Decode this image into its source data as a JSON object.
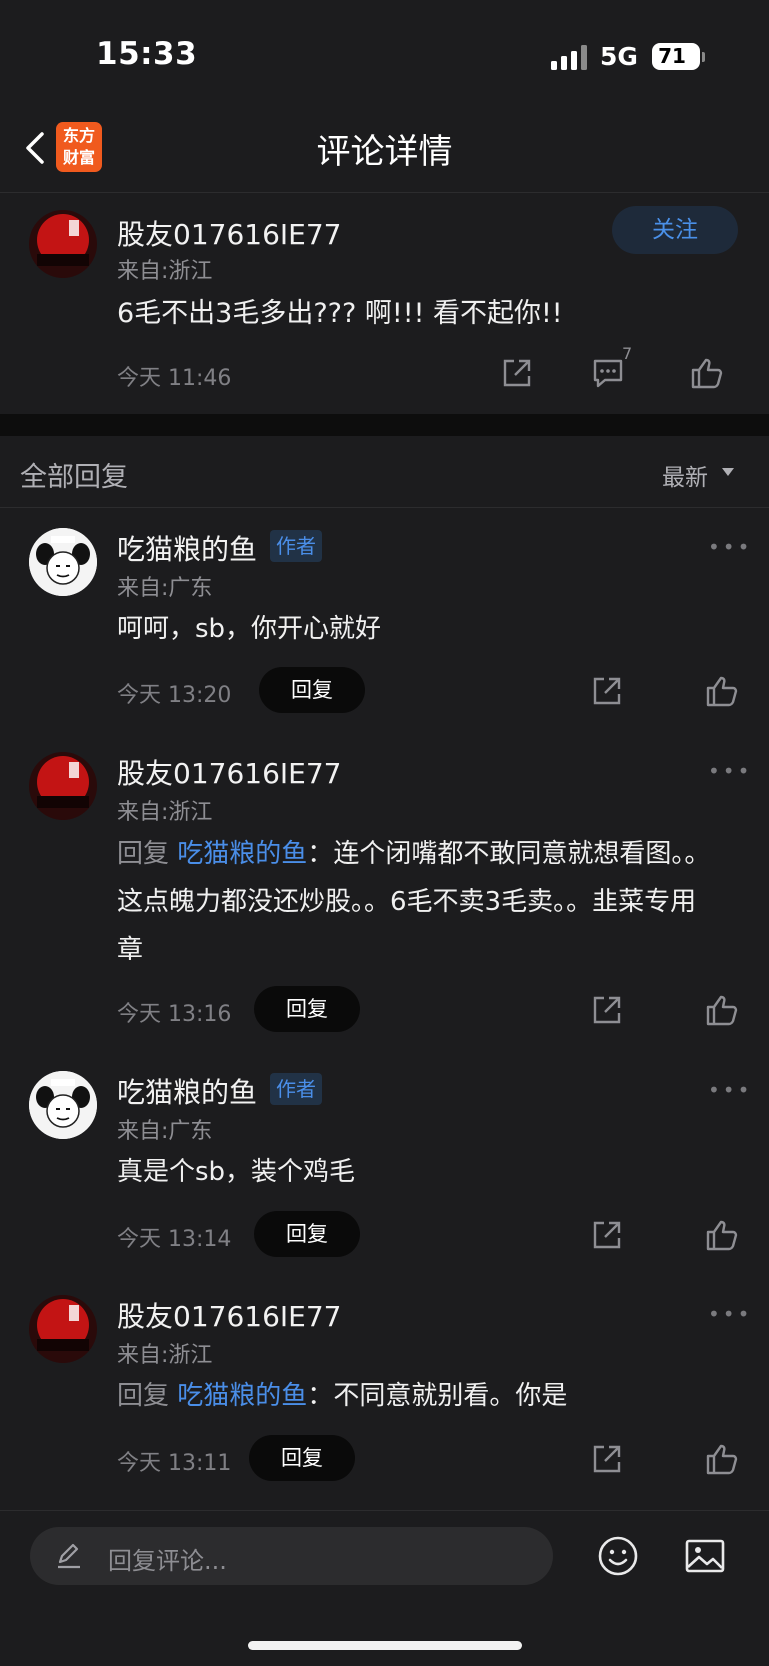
{
  "status_bar": {
    "time": "15:33",
    "network": "5G",
    "battery": "71"
  },
  "nav": {
    "title": "评论详情",
    "logo_line1": "东方",
    "logo_line2": "财富"
  },
  "main_comment": {
    "user": "股友017616IE77",
    "location": "来自:浙江",
    "follow_label": "关注",
    "content": "6毛不出3毛多出??? 啊!!! 看不起你!!",
    "time": "今天 11:46",
    "reply_count": "7"
  },
  "replies_header": {
    "title": "全部回复",
    "sort": "最新"
  },
  "replies": [
    {
      "user": "吃猫粮的鱼",
      "tag": "作者",
      "location": "来自:广东",
      "content": "呵呵，sb，你开心就好",
      "time": "今天 13:20",
      "reply_label": "回复",
      "more": "•••"
    },
    {
      "user": "股友017616IE77",
      "location": "来自:浙江",
      "reply_prefix": "回复",
      "mention": "吃猫粮的鱼",
      "colon": "：",
      "content": "连个闭嘴都不敢同意就想看图。。这点魄力都没还炒股。。6毛不卖3毛卖。。韭菜专用章",
      "time": "今天 13:16",
      "reply_label": "回复",
      "more": "•••"
    },
    {
      "user": "吃猫粮的鱼",
      "tag": "作者",
      "location": "来自:广东",
      "content": "真是个sb，装个鸡毛",
      "time": "今天 13:14",
      "reply_label": "回复",
      "more": "•••"
    },
    {
      "user": "股友017616IE77",
      "location": "来自:浙江",
      "reply_prefix": "回复",
      "mention": "吃猫粮的鱼",
      "colon": "：",
      "content": "不同意就别看。你是",
      "time": "今天 13:11",
      "reply_label": "回复",
      "more": "•••"
    }
  ],
  "composer": {
    "placeholder": "回复评论..."
  },
  "icons": [
    "back-icon",
    "share-icon",
    "comment-icon",
    "like-icon",
    "more-icon",
    "pen-icon",
    "emoji-icon",
    "image-icon"
  ],
  "colors": {
    "accent": "#4a8ee8",
    "logo": "#f05a1e",
    "background": "#1c1c1e"
  }
}
